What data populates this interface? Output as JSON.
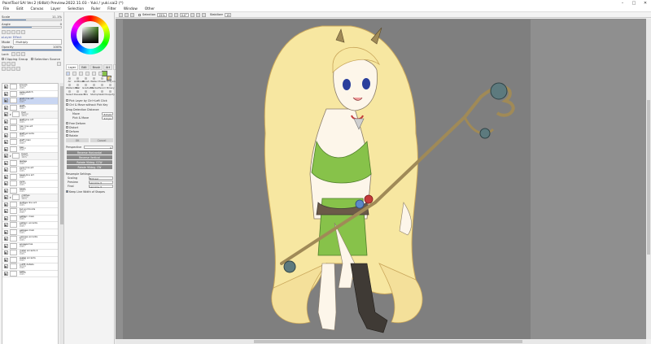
{
  "window": {
    "title": "PaintTool SAI Ver.2 (64bit) Preview.2022.11.03 - Yuki / yuki.sai2 (*)",
    "controls": [
      "–",
      "□",
      "✕"
    ]
  },
  "menu": [
    "File",
    "Edit",
    "Canvas",
    "Layer",
    "Selection",
    "Ruler",
    "Filter",
    "Window",
    "Other"
  ],
  "left_panel": {
    "scale_label": "Scale",
    "scale_value": "11.1%",
    "angle_label": "Angle",
    "angle_value": "0",
    "section_label": "Layer Effect",
    "mode_label": "Mode",
    "mode_value": "Multiply",
    "opacity_label": "Opacity",
    "opacity_value": "100%",
    "lock_label": "Lock",
    "clipping_label": "Clipping Group",
    "selection_source_label": "Selection Source"
  },
  "layers": [
    {
      "name": "bronze",
      "mode": "Normal",
      "opacity": "100%",
      "type": "layer"
    },
    {
      "name": "eyes sketch",
      "mode": "Normal",
      "opacity": "100%",
      "type": "layer"
    },
    {
      "name": "walk line art",
      "mode": "Normal",
      "opacity": "100%",
      "type": "layer",
      "selected": true
    },
    {
      "name": "staff",
      "mode": "Normal",
      "opacity": "100%",
      "type": "layer"
    },
    {
      "name": "hair",
      "mode": "Normal",
      "opacity": "100%",
      "type": "folder"
    },
    {
      "name": "staff line art",
      "mode": "Normal",
      "opacity": "100%",
      "type": "layer"
    },
    {
      "name": "hair line art",
      "mode": "Normal",
      "opacity": "100%",
      "type": "layer"
    },
    {
      "name": "staff accents",
      "mode": "Normal",
      "opacity": "100%",
      "type": "layer"
    },
    {
      "name": "staff main",
      "mode": "Normal",
      "opacity": "100%",
      "type": "layer"
    },
    {
      "name": "hair",
      "mode": "Normal",
      "opacity": "100%",
      "type": "layer"
    },
    {
      "name": "head",
      "mode": "Normal",
      "opacity": "100%",
      "type": "folder"
    },
    {
      "name": "lashes",
      "mode": "Normal",
      "opacity": "100%",
      "type": "layer"
    },
    {
      "name": "eyes line art",
      "mode": "Normal",
      "opacity": "100%",
      "type": "layer"
    },
    {
      "name": "head line art",
      "mode": "Normal",
      "opacity": "100%",
      "type": "layer"
    },
    {
      "name": "eyes",
      "mode": "Normal",
      "opacity": "100%",
      "type": "layer"
    },
    {
      "name": "head",
      "mode": "Normal",
      "opacity": "100%",
      "type": "layer"
    },
    {
      "name": "clothes",
      "mode": "Normal",
      "opacity": "100%",
      "type": "folder"
    },
    {
      "name": "clothes line art",
      "mode": "Normal",
      "opacity": "100%",
      "type": "layer"
    },
    {
      "name": "tail and boots",
      "mode": "Normal",
      "opacity": "100%",
      "type": "layer"
    },
    {
      "name": "pattern main",
      "mode": "Normal",
      "opacity": "100%",
      "type": "layer"
    },
    {
      "name": "pattern accents",
      "mode": "Normal",
      "opacity": "100%",
      "type": "layer"
    },
    {
      "name": "yellows main",
      "mode": "Normal",
      "opacity": "100%",
      "type": "layer"
    },
    {
      "name": "yellows accents",
      "mode": "Normal",
      "opacity": "100%",
      "type": "layer"
    },
    {
      "name": "accessories",
      "mode": "Normal",
      "opacity": "100%",
      "type": "layer"
    },
    {
      "name": "metal accents 2",
      "mode": "Normal",
      "opacity": "100%",
      "type": "layer"
    },
    {
      "name": "metal accents",
      "mode": "Normal",
      "opacity": "100%",
      "type": "layer"
    },
    {
      "name": "outfit details",
      "mode": "Normal",
      "opacity": "100%",
      "type": "layer"
    },
    {
      "name": "belts",
      "mode": "Normal",
      "opacity": "100%",
      "type": "layer"
    }
  ],
  "tool_panel": {
    "tabs": [
      "Layer",
      "Edit",
      "Brush",
      "Art",
      "Blender"
    ],
    "tools": [
      "Air",
      "AirBrush",
      "Brush",
      "Water",
      "Eraser",
      "Crayon",
      "Watercolor",
      "Blur",
      "Gradient",
      "Marker",
      "Pencil",
      "Binary",
      "Select",
      "Deselect",
      "Mix",
      "Stamp",
      "Sketch",
      "Liquify"
    ],
    "opt1": "Pick Layer by Ctrl+Left Click",
    "opt2": "Ctrl & Move without Pick Key",
    "drag_label": "Drag Detection Distance",
    "move_label": "Move",
    "move_value": "4.0 px",
    "pickmove_label": "Pick & Move",
    "pickmove_value": "4.0 px",
    "transform_opts": [
      "Free Deform",
      "Distort",
      "Deform",
      "Rotate"
    ],
    "ok_label": "OK",
    "cancel_label": "Cancel",
    "perspective_label": "Perspective",
    "perspective_value": "0",
    "actions": [
      "Reverse Horizontal",
      "Reverse Vertical",
      "Rotate 90deg. CCW",
      "Rotate 90deg. CW"
    ],
    "resample_label": "Resample Settings",
    "scaling_label": "Scaling",
    "scaling_value": "Bilinear",
    "preview_label": "Preview",
    "preview_value": "Lanczos 3",
    "final_label": "Final",
    "final_value": "Lanczos 3",
    "keep_label": "Keep Line Width of Shapes"
  },
  "canvas_toolbar": {
    "selection_label": "Selection",
    "zoom_value": "25%",
    "angle_value": "0.0°",
    "stabilizer_label": "Stabilizer",
    "stabilizer_value": "15"
  },
  "colors": {
    "canvas_bg": "#7f7f7f",
    "hair": "#f7e7a1",
    "hair_shadow": "#e9cf7a",
    "outfit_green": "#87c24a",
    "staff": "#a08a57",
    "orb": "#5d7a7e",
    "boots": "#3f3a35",
    "skin": "#fdf6ea"
  }
}
